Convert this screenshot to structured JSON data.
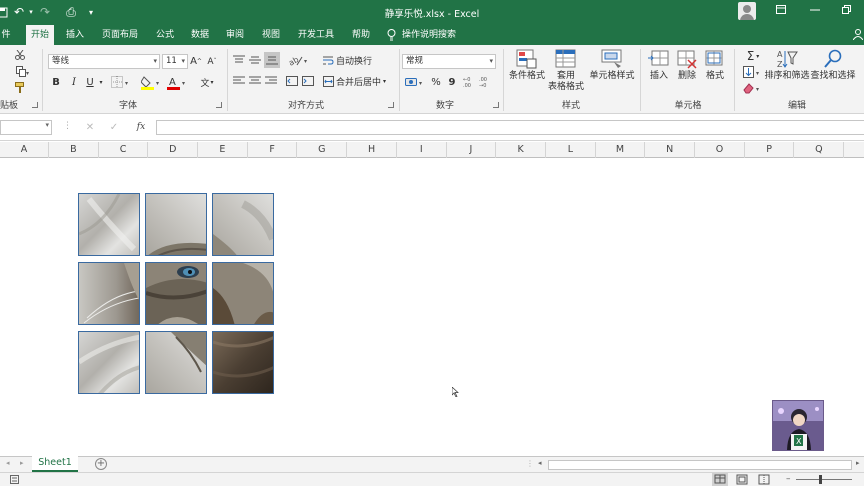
{
  "titlebar": {
    "title": "静享乐悦.xlsx  -  Excel",
    "qa_undo": "↶",
    "qa_redo": "↷",
    "qa_preview": "⎙",
    "qa_more": "▾"
  },
  "tabs": [
    {
      "label": "件"
    },
    {
      "label": "开始"
    },
    {
      "label": "插入"
    },
    {
      "label": "页面布局"
    },
    {
      "label": "公式"
    },
    {
      "label": "数据"
    },
    {
      "label": "审阅"
    },
    {
      "label": "视图"
    },
    {
      "label": "开发工具"
    },
    {
      "label": "帮助"
    },
    {
      "label": "操作说明搜索"
    }
  ],
  "ribbon": {
    "clipboard_label": "贴板",
    "font_label": "字体",
    "font_name": "等线",
    "font_size": "11",
    "grow_font": "A",
    "shrink_font": "A",
    "bold": "B",
    "italic": "I",
    "underline": "U",
    "font_color_glyph": "A",
    "phonetic_glyph": "文",
    "align_label": "对齐方式",
    "wrap_text": "自动换行",
    "merge_center": "合并后居中",
    "number_label": "数字",
    "number_format": "常规",
    "percent": "%",
    "comma": "9",
    "styles_label": "样式",
    "cond_format": "条件格式",
    "table_format_1": "套用",
    "table_format_2": "表格格式",
    "cell_styles": "单元格样式",
    "cells_label": "单元格",
    "insert": "插入",
    "delete": "删除",
    "format": "格式",
    "editing_label": "编辑",
    "autosum": "Σ",
    "sort_filter": "排序和筛选",
    "find_select": "查找和选择"
  },
  "formula_bar": {
    "cancel": "✕",
    "enter": "✓",
    "fx": "fx"
  },
  "columns": [
    "A",
    "B",
    "C",
    "D",
    "E",
    "F",
    "G",
    "H",
    "I",
    "J",
    "K",
    "L",
    "M",
    "N",
    "O",
    "P",
    "Q"
  ],
  "sheet_tabs": {
    "sheet1": "Sheet1",
    "add": "+"
  },
  "colors": {
    "brand": "#217346",
    "piece_border": "#3a6aa0"
  }
}
